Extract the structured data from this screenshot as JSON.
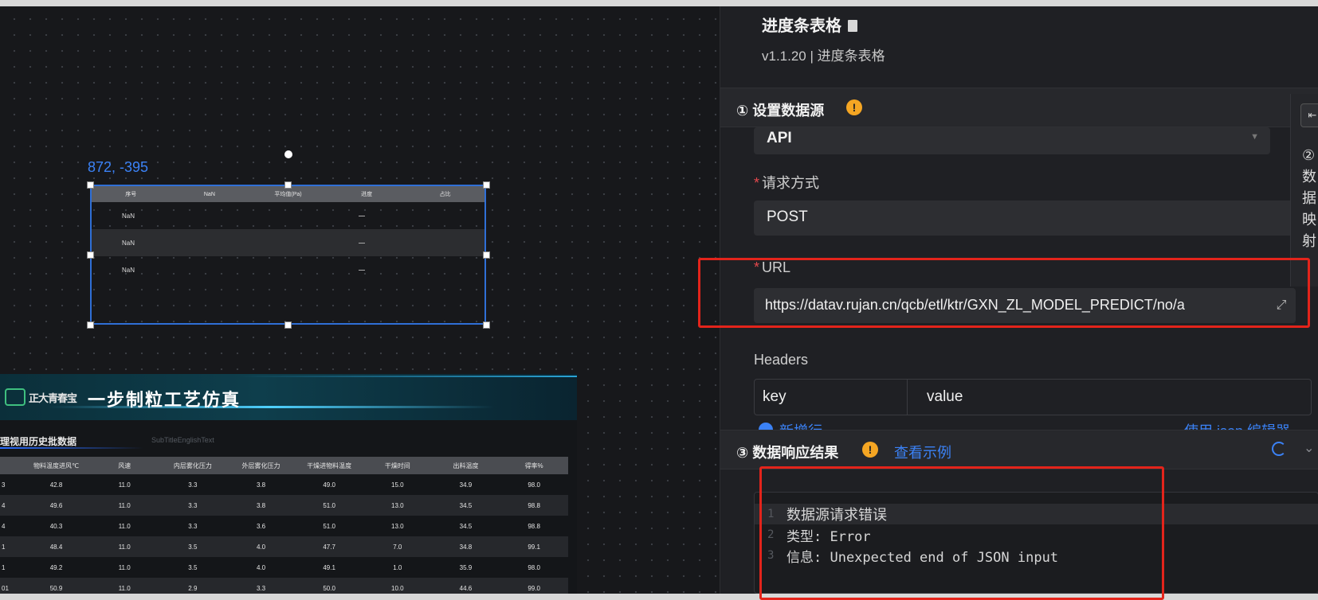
{
  "canvas": {
    "coord_readout": "872, -395",
    "mini_table": {
      "headers": [
        "序号",
        "NaN",
        "平均值(Pa)",
        "进度",
        "占比"
      ],
      "rows": [
        "NaN",
        "NaN",
        "NaN"
      ]
    },
    "dashboard": {
      "logo_text": "正大青春宝",
      "title": "一步制粒工艺仿真",
      "subtitle": "理视用历史批数据",
      "subtitle_en": "SubTitleEnglishText",
      "table_headers": [
        "",
        "物料温度进风℃",
        "风速",
        "内层雾化压力",
        "外层雾化压力",
        "干燥进物料温度",
        "干燥时间",
        "出料温度",
        "得率%"
      ],
      "table_rows": [
        [
          "3",
          "42.8",
          "11.0",
          "3.3",
          "3.8",
          "49.0",
          "15.0",
          "34.9",
          "98.0"
        ],
        [
          "4",
          "49.6",
          "11.0",
          "3.3",
          "3.8",
          "51.0",
          "13.0",
          "34.5",
          "98.8"
        ],
        [
          "4",
          "40.3",
          "11.0",
          "3.3",
          "3.6",
          "51.0",
          "13.0",
          "34.5",
          "98.8"
        ],
        [
          "1",
          "48.4",
          "11.0",
          "3.5",
          "4.0",
          "47.7",
          "7.0",
          "34.8",
          "99.1"
        ],
        [
          "1",
          "49.2",
          "11.0",
          "3.5",
          "4.0",
          "49.1",
          "1.0",
          "35.9",
          "98.0"
        ],
        [
          "01",
          "50.9",
          "11.0",
          "2.9",
          "3.3",
          "50.0",
          "10.0",
          "44.6",
          "99.0"
        ]
      ]
    }
  },
  "panel": {
    "title": "进度条表格",
    "version": "v1.1.20 | 进度条表格",
    "section1": {
      "label": "① 设置数据源",
      "warn": "!"
    },
    "source_type": "API",
    "method": {
      "label": "请求方式",
      "value": "POST"
    },
    "url": {
      "label": "URL",
      "value": "https://datav.rujan.cn/qcb/etl/ktr/GXN_ZL_MODEL_PREDICT/no/a"
    },
    "headers": {
      "label": "Headers",
      "key_placeholder": "key",
      "value_placeholder": "value"
    },
    "add_row": "新增行",
    "json_editor": "使用 json 编辑器",
    "section3": {
      "label": "③ 数据响应结果",
      "warn": "!",
      "example_link": "查看示例"
    },
    "side_tab": {
      "text": "②数据映射"
    },
    "response_lines": [
      {
        "num": "1",
        "text": "数据源请求错误"
      },
      {
        "num": "2",
        "text": "类型: Error"
      },
      {
        "num": "3",
        "text": "信息: Unexpected end of JSON input"
      }
    ]
  },
  "colors": {
    "accent": "#3b82f6",
    "warn": "#f5a623",
    "highlight_red": "#e3241b"
  }
}
